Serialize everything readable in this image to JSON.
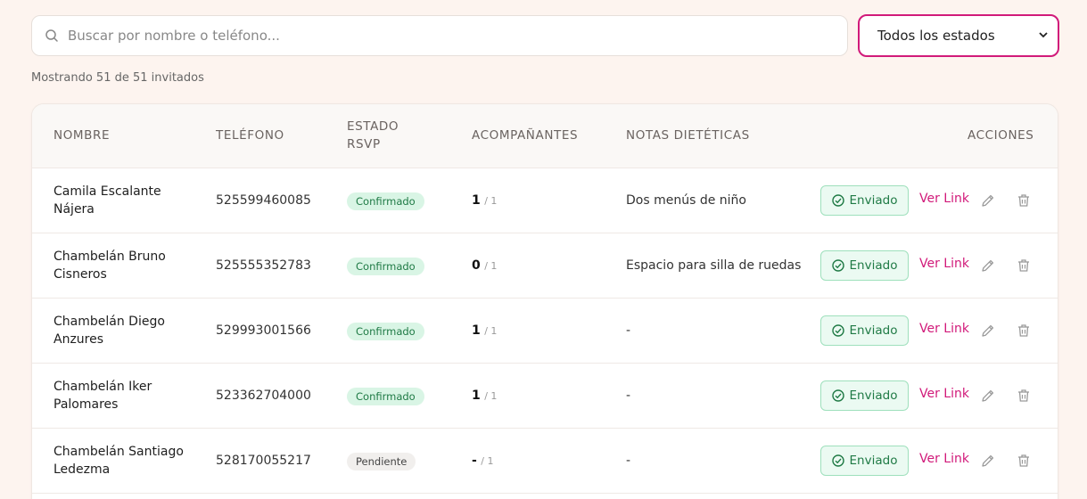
{
  "search": {
    "placeholder": "Buscar por nombre o teléfono...",
    "value": ""
  },
  "filter": {
    "selected": "Todos los estados",
    "accent": "#d11a7a"
  },
  "summary": "Mostrando 51 de 51 invitados",
  "table": {
    "headers": {
      "name": "NOMBRE",
      "phone": "TELÉFONO",
      "status_line1": "ESTADO",
      "status_line2": "RSVP",
      "companions": "ACOMPAÑANTES",
      "notes": "NOTAS DIETÉTICAS",
      "actions": "ACCIONES"
    },
    "rows": [
      {
        "name_line1": "Camila Escalante",
        "name_line2": "Nájera",
        "phone": "525599460085",
        "status": "Confirmado",
        "status_kind": "confirmed",
        "companions": "1",
        "companions_max": "/ 1",
        "notes": "Dos menús de niño",
        "sent": "Enviado",
        "link": "Ver Link"
      },
      {
        "name_line1": "Chambelán Bruno",
        "name_line2": "Cisneros",
        "phone": "525555352783",
        "status": "Confirmado",
        "status_kind": "confirmed",
        "companions": "0",
        "companions_max": "/ 1",
        "notes": "Espacio para silla de ruedas",
        "sent": "Enviado",
        "link": "Ver Link"
      },
      {
        "name_line1": "Chambelán Diego",
        "name_line2": "Anzures",
        "phone": "529993001566",
        "status": "Confirmado",
        "status_kind": "confirmed",
        "companions": "1",
        "companions_max": "/ 1",
        "notes": "-",
        "sent": "Enviado",
        "link": "Ver Link"
      },
      {
        "name_line1": "Chambelán Iker",
        "name_line2": "Palomares",
        "phone": "523362704000",
        "status": "Confirmado",
        "status_kind": "confirmed",
        "companions": "1",
        "companions_max": "/ 1",
        "notes": "-",
        "sent": "Enviado",
        "link": "Ver Link"
      },
      {
        "name_line1": "Chambelán Santiago",
        "name_line2": "Ledezma",
        "phone": "528170055217",
        "status": "Pendiente",
        "status_kind": "pending",
        "companions": "-",
        "companions_max": "/ 1",
        "notes": "-",
        "sent": "Enviado",
        "link": "Ver Link"
      }
    ]
  },
  "icons": {
    "search": "search-icon",
    "chevron": "chevron-down-icon",
    "check": "check-circle-icon",
    "edit": "pencil-icon",
    "delete": "trash-icon"
  },
  "colors": {
    "accent": "#d11a7a",
    "confirmed_bg": "#d9f5e5",
    "confirmed_fg": "#1f7a45",
    "pending_bg": "#f1efed"
  }
}
